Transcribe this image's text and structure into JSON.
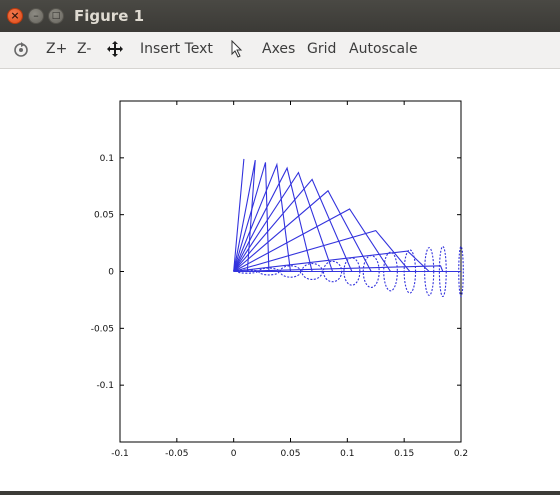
{
  "window": {
    "title": "Figure 1",
    "close_glyph": "×",
    "min_glyph": "–",
    "max_glyph": "□"
  },
  "toolbar": {
    "icons": [
      "rotate-icon",
      "pan-icon",
      "pointer-icon"
    ],
    "zoom_in": "Z+",
    "zoom_out": "Z-",
    "insert_text": "Insert Text",
    "axes": "Axes",
    "grid": "Grid",
    "autoscale": "Autoscale"
  },
  "chart_data": {
    "type": "line",
    "title": "",
    "xlabel": "",
    "ylabel": "",
    "xlim": [
      -0.1,
      0.2
    ],
    "ylim": [
      -0.15,
      0.15
    ],
    "xticks": [
      "-0.1",
      "-0.05",
      "0",
      "0.05",
      "0.1",
      "0.15",
      "0.2"
    ],
    "yticks": [
      "0.1",
      "0.05",
      "0",
      "-0.05",
      "-0.1"
    ],
    "grid": false,
    "color": "#3333dd",
    "series": [
      {
        "tip": [
          0.009,
          0.099
        ],
        "ellipse_center": [
          0.0,
          0
        ],
        "ellipse_rx": 0.0,
        "ellipse_ry": 0.0
      },
      {
        "tip": [
          0.019,
          0.098
        ],
        "ellipse_center": [
          0.012,
          0
        ],
        "ellipse_rx": 0.009,
        "ellipse_ry": 0.0015
      },
      {
        "tip": [
          0.028,
          0.096
        ],
        "ellipse_center": [
          0.031,
          0
        ],
        "ellipse_rx": 0.009,
        "ellipse_ry": 0.003
      },
      {
        "tip": [
          0.038,
          0.094
        ],
        "ellipse_center": [
          0.05,
          0
        ],
        "ellipse_rx": 0.009,
        "ellipse_ry": 0.005
      },
      {
        "tip": [
          0.047,
          0.091
        ],
        "ellipse_center": [
          0.069,
          0
        ],
        "ellipse_rx": 0.009,
        "ellipse_ry": 0.007
      },
      {
        "tip": [
          0.057,
          0.087
        ],
        "ellipse_center": [
          0.087,
          0
        ],
        "ellipse_rx": 0.008,
        "ellipse_ry": 0.009
      },
      {
        "tip": [
          0.069,
          0.081
        ],
        "ellipse_center": [
          0.104,
          0
        ],
        "ellipse_rx": 0.007,
        "ellipse_ry": 0.012
      },
      {
        "tip": [
          0.083,
          0.071
        ],
        "ellipse_center": [
          0.121,
          0
        ],
        "ellipse_rx": 0.007,
        "ellipse_ry": 0.014
      },
      {
        "tip": [
          0.102,
          0.055
        ],
        "ellipse_center": [
          0.138,
          0
        ],
        "ellipse_rx": 0.006,
        "ellipse_ry": 0.017
      },
      {
        "tip": [
          0.125,
          0.036
        ],
        "ellipse_center": [
          0.155,
          0
        ],
        "ellipse_rx": 0.005,
        "ellipse_ry": 0.019
      },
      {
        "tip": [
          0.153,
          0.018
        ],
        "ellipse_center": [
          0.172,
          0
        ],
        "ellipse_rx": 0.004,
        "ellipse_ry": 0.021
      },
      {
        "tip": [
          0.182,
          0.005
        ],
        "ellipse_center": [
          0.184,
          0
        ],
        "ellipse_rx": 0.003,
        "ellipse_ry": 0.022
      },
      {
        "tip": [
          0.2,
          0.0
        ],
        "ellipse_center": [
          0.2,
          0
        ],
        "ellipse_rx": 0.002,
        "ellipse_ry": 0.022
      }
    ]
  }
}
